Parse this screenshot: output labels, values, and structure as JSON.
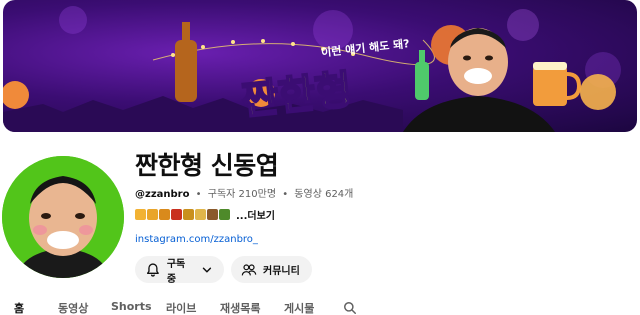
{
  "banner": {
    "title_art": "짠한형",
    "speech": "이런 얘기 해도 돼?"
  },
  "channel": {
    "name": "짠한형 신동엽",
    "handle": "@zzanbro",
    "subscribers": "구독자 210만명",
    "videos": "동영상 624개",
    "separator": "•",
    "description_more": "...더보기",
    "link": "instagram.com/zzanbro_",
    "emoji_colors": [
      "#f2b233",
      "#e9a52a",
      "#d98a1c",
      "#c9301f",
      "#c9901d",
      "#e0b64b",
      "#8a5a2b",
      "#4e8a2a"
    ]
  },
  "buttons": {
    "subscribe": "구독중",
    "community": "커뮤니티"
  },
  "tabs": [
    "홈",
    "동영상",
    "Shorts",
    "라이브",
    "재생목록",
    "게시물"
  ],
  "colors": {
    "link": "#065fd4",
    "avatar_bg": "#52c51a",
    "banner_purple": "#3b0d73",
    "button_bg": "#f2f2f2"
  }
}
